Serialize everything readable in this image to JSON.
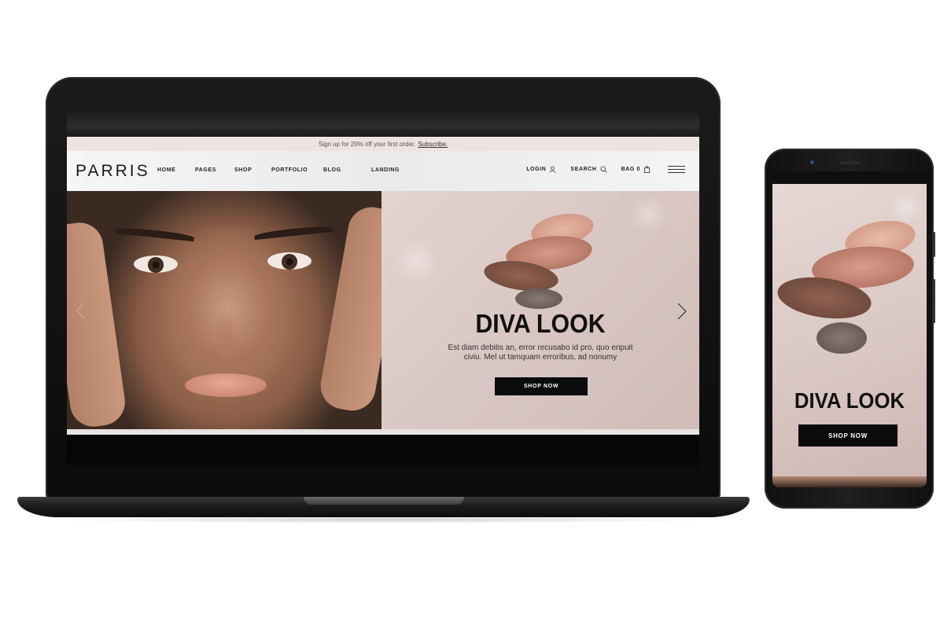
{
  "site": {
    "promo_text": "Sign up for 20% off your first order.",
    "promo_link": "Subscribe.",
    "logo": "PARRIS",
    "menu": [
      "HOME",
      "PAGES",
      "SHOP",
      "PORTFOLIO",
      "BLOG",
      "LANDING"
    ],
    "login_label": "LOGIN",
    "search_label": "SEARCH",
    "bag_label": "BAG 0",
    "hero_title": "DIVA LOOK",
    "hero_text": "Est diam debitis an, error recusabo id pro, quo eripuit civiu. Mel ut tamquam erroribus, ad nonumy",
    "hero_button": "SHOP NOW"
  },
  "phone": {
    "hero_title": "DIVA LOOK",
    "hero_button": "SHOP NOW"
  },
  "colors": {
    "promo_bg": "#efe3e1",
    "hero_bg": "#dccbc7",
    "button_bg": "#0b0b0b",
    "device_frame": "#111111"
  }
}
